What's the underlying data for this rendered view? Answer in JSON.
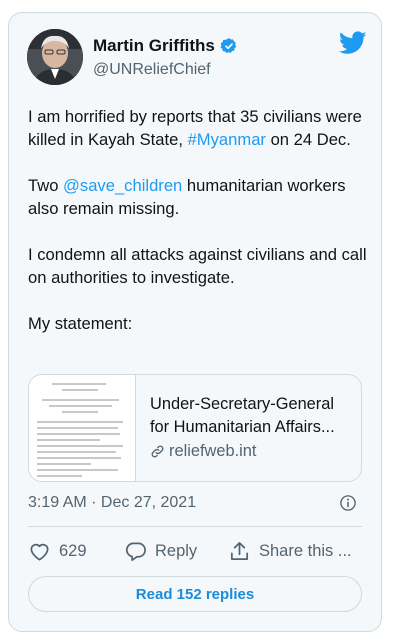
{
  "author": {
    "display_name": "Martin Griffiths",
    "handle": "@UNReliefChief",
    "avatar_icon": "person-portrait",
    "verified_icon": "verified-badge-icon"
  },
  "brand": {
    "logo": "twitter-bird-icon",
    "accent_color": "#1d9bf0"
  },
  "tweet": {
    "p1_a": "I am horrified by reports that 35 civilians were killed in Kayah State, ",
    "p1_hashtag": "#Myanmar",
    "p1_b": " on 24 Dec.",
    "p2_a": "Two ",
    "p2_mention": "@save_children",
    "p2_b": " humanitarian workers also remain missing.",
    "p3": "I condemn all attacks against civilians and call on authorities to investigate.",
    "p4": "My statement:"
  },
  "link_card": {
    "title": "Under-Secretary-General for Humanitarian Affairs...",
    "domain": "reliefweb.int",
    "icon": "link-icon"
  },
  "timestamp": "3:19 AM · Dec 27, 2021",
  "actions": {
    "like_count": "629",
    "reply_label": "Reply",
    "share_label": "Share this ..."
  },
  "read_replies_label": "Read 152 replies"
}
